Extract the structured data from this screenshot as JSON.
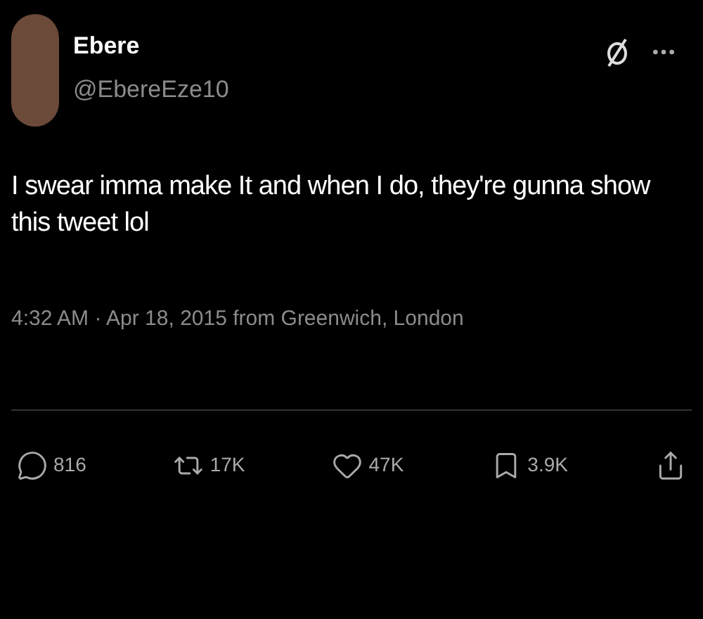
{
  "author": {
    "name": "Ebere",
    "handle": "@EbereEze10"
  },
  "text": "I swear imma make It and when I do, they're gunna show this tweet lol",
  "meta": "4:32 AM · Apr 18, 2015 from Greenwich, London",
  "actions": [
    {
      "kind": "reply",
      "count": "816"
    },
    {
      "kind": "retweet",
      "count": "17K"
    },
    {
      "kind": "like",
      "count": "47K"
    },
    {
      "kind": "bookmark",
      "count": "3.9K"
    },
    {
      "kind": "share"
    }
  ]
}
